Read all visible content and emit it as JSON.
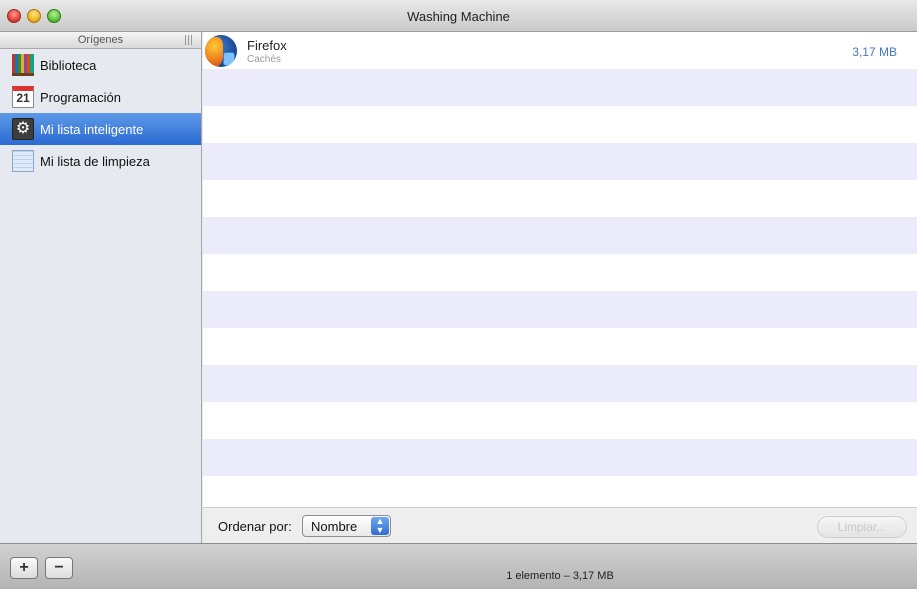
{
  "window": {
    "title": "Washing Machine"
  },
  "sidebar": {
    "header": "Orígenes",
    "items": [
      {
        "label": "Biblioteca",
        "icon": "library-icon"
      },
      {
        "label": "Programación",
        "icon": "calendar-icon",
        "icon_text": "21"
      },
      {
        "label": "Mi lista inteligente",
        "icon": "smart-list-gear-icon",
        "selected": true
      },
      {
        "label": "Mi lista de limpieza",
        "icon": "list-icon"
      }
    ]
  },
  "main": {
    "rows": [
      {
        "name": "Firefox",
        "subtitle": "Cachés",
        "size": "3,17 MB",
        "icon": "firefox-icon"
      }
    ]
  },
  "sortbar": {
    "label": "Ordenar por:",
    "selected": "Nombre",
    "clean_button": "Limpiar..."
  },
  "bottombar": {
    "add_label": "+",
    "remove_label": "−",
    "status": "1 elemento – 3,17 MB"
  },
  "colors": {
    "selection": "#2a6ad2",
    "size_text": "#4777c9",
    "stripe": "#ebebfb"
  }
}
